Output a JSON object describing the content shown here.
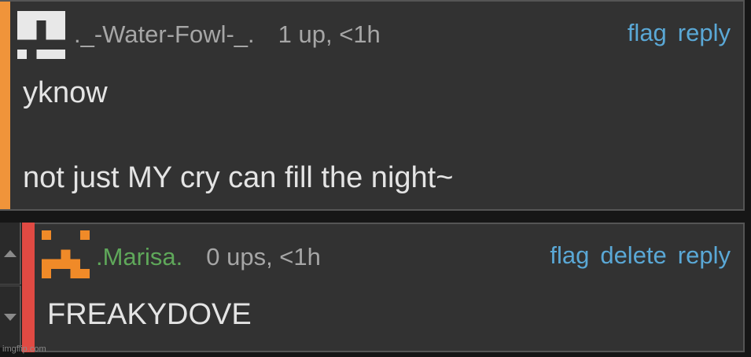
{
  "comments": [
    {
      "username": "._-Water-Fowl-_.",
      "votes": "1 up, <1h",
      "actions": [
        "flag",
        "reply"
      ],
      "body_line1": "yknow",
      "body_line2": "not just MY cry can fill the night~",
      "accent_color": "#f0943a",
      "avatar_color": "#e8e8e8"
    },
    {
      "username": ".Marisa.",
      "votes": "0 ups, <1h",
      "actions": [
        "flag",
        "delete",
        "reply"
      ],
      "body_line1": "FREAKYDOVE",
      "accent_color": "#e04a43",
      "avatar_color": "#f08a28"
    }
  ],
  "watermark": "imgflip.com",
  "colors": {
    "background": "#161616",
    "card": "#323232",
    "link": "#5aa8d6",
    "muted": "#a6a6a6",
    "username_green": "#5fa85a",
    "body_text": "#e4e4e4"
  }
}
